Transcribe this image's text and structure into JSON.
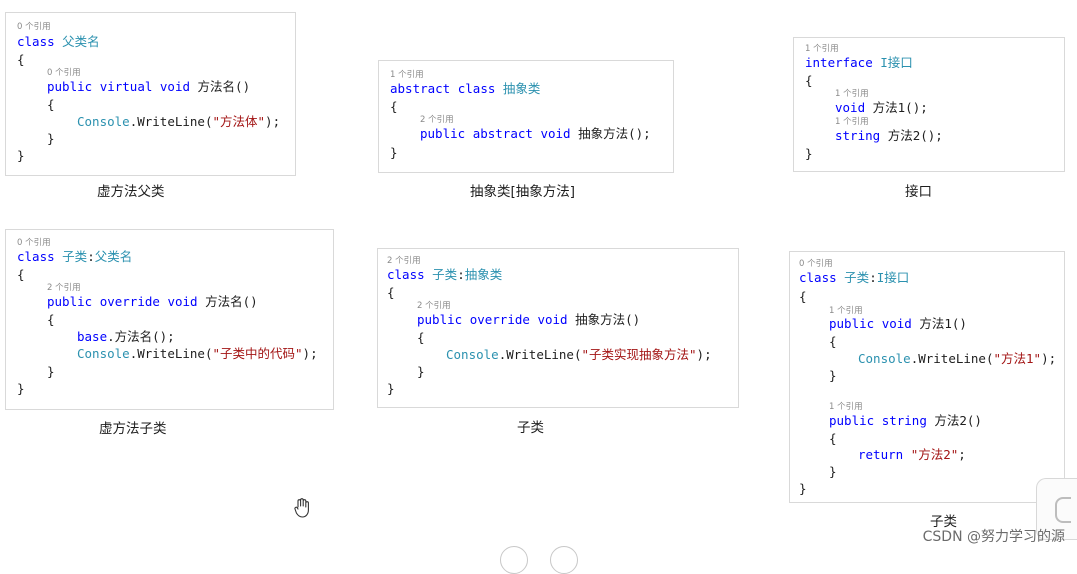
{
  "panels": {
    "virtual_parent": {
      "ref_class": "0 个引用",
      "kw_class": "class",
      "class_name": "父类名",
      "brace_open": "{",
      "ref_method": "0 个引用",
      "kw_public": "public",
      "kw_virtual": "virtual",
      "kw_void": "void",
      "method_sig": "方法名()",
      "inner_open": "{",
      "console": "Console",
      "writeline": ".WriteLine(",
      "str": "\"方法体\"",
      "stmt_end": ");",
      "inner_close": "}",
      "brace_close": "}"
    },
    "abstract_class": {
      "ref_class": "1 个引用",
      "kw_abstract": "abstract",
      "kw_class": "class",
      "class_name": "抽象类",
      "brace_open": "{",
      "ref_method": "2 个引用",
      "kw_public": "public",
      "kw_void": "void",
      "method_sig": "抽象方法();",
      "brace_close": "}"
    },
    "interface": {
      "ref_iface": "1 个引用",
      "kw_interface": "interface",
      "iface_name": "I接口",
      "brace_open": "{",
      "ref_m1": "1 个引用",
      "kw_void": "void",
      "m1_sig": "方法1();",
      "ref_m2": "1 个引用",
      "kw_string": "string",
      "m2_sig": "方法2();",
      "brace_close": "}"
    },
    "virtual_child": {
      "ref_class": "0 个引用",
      "kw_class": "class",
      "class_name": "子类",
      "colon": ":",
      "base_name": "父类名",
      "brace_open": "{",
      "ref_method": "2 个引用",
      "kw_public": "public",
      "kw_override": "override",
      "kw_void": "void",
      "method_sig": "方法名()",
      "inner_open": "{",
      "kw_base": "base",
      "base_call": ".方法名();",
      "console": "Console",
      "writeline": ".WriteLine(",
      "str": "\"子类中的代码\"",
      "stmt_end": ");",
      "inner_close": "}",
      "brace_close": "}"
    },
    "abstract_child": {
      "ref_class": "2 个引用",
      "kw_class": "class",
      "class_name": "子类",
      "colon": ":",
      "base_name": "抽象类",
      "brace_open": "{",
      "ref_method": "2 个引用",
      "kw_public": "public",
      "kw_override": "override",
      "kw_void": "void",
      "method_sig": "抽象方法()",
      "inner_open": "{",
      "console": "Console",
      "writeline": ".WriteLine(",
      "str": "\"子类实现抽象方法\"",
      "stmt_end": ");",
      "inner_close": "}",
      "brace_close": "}"
    },
    "interface_child": {
      "ref_class": "0 个引用",
      "kw_class": "class",
      "class_name": "子类",
      "colon": ":",
      "base_name": "I接口",
      "brace_open": "{",
      "ref_m1": "1 个引用",
      "kw_public1": "public",
      "kw_void": "void",
      "m1_sig": "方法1()",
      "m1_open": "{",
      "console": "Console",
      "writeline": ".WriteLine(",
      "str1": "\"方法1\"",
      "stmt_end1": ");",
      "m1_close": "}",
      "ref_m2": "1 个引用",
      "kw_public2": "public",
      "kw_string": "string",
      "m2_sig": "方法2()",
      "m2_open": "{",
      "kw_return": "return",
      "str2": "\"方法2\"",
      "stmt_end2": ";",
      "m2_close": "}",
      "brace_close": "}"
    }
  },
  "captions": {
    "virtual_parent": "虚方法父类",
    "abstract_class": "抽象类[抽象方法]",
    "interface": "接口",
    "virtual_child": "虚方法子类",
    "abstract_child": "子类",
    "interface_child": "子类"
  },
  "watermark": "CSDN @努力学习的源",
  "icons": [
    "hand-cursor-icon"
  ],
  "colors": {
    "keyword": "#0000ff",
    "type_name": "#2b91af",
    "string": "#a31515",
    "reference_hint": "#8a8a8a"
  }
}
